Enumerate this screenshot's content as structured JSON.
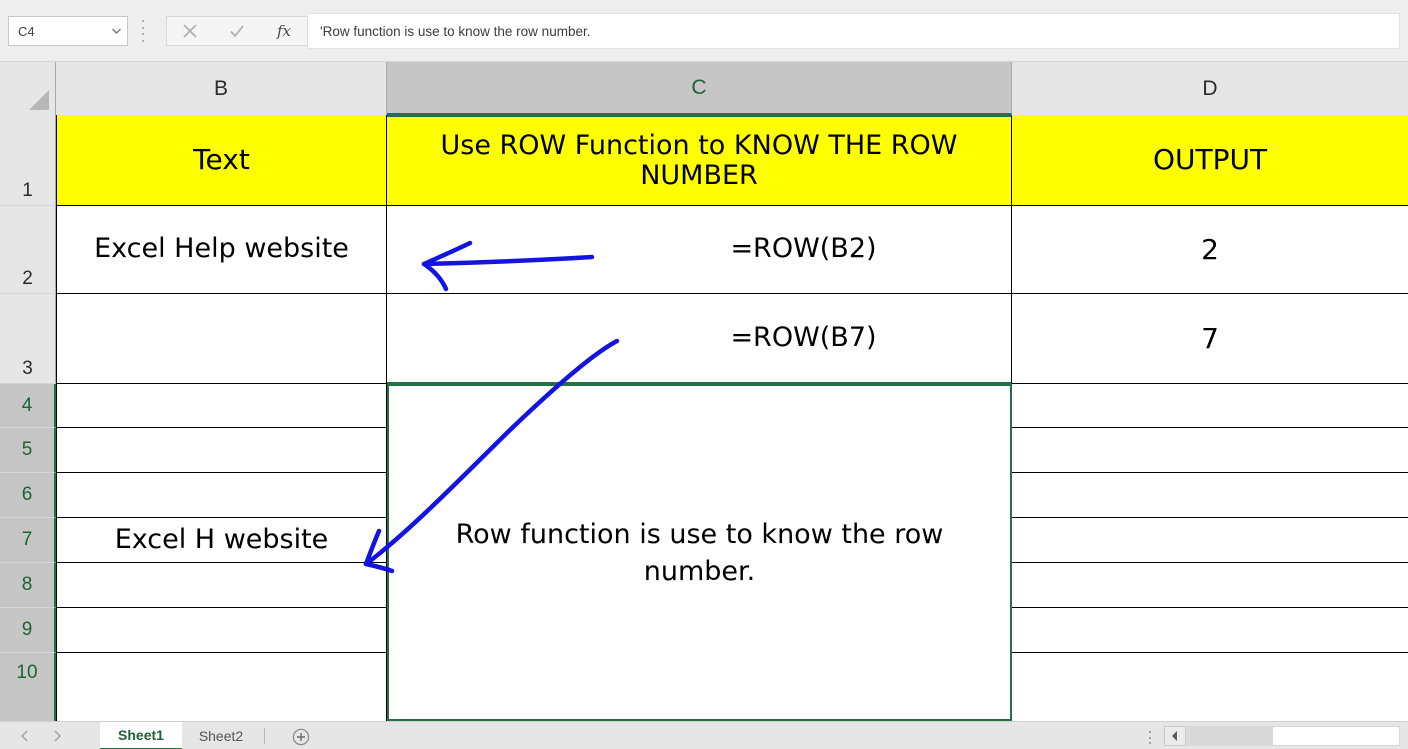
{
  "formula_bar": {
    "name_box_value": "C4",
    "name_box_dropdown_icon": "chevron-down-icon",
    "cancel_icon": "close-x-icon",
    "confirm_icon": "checkmark-icon",
    "function_icon": "fx-insert-function-icon",
    "formula_value": "'Row function is use to know the row number."
  },
  "grid": {
    "columns": [
      {
        "label": "B",
        "selected": false
      },
      {
        "label": "C",
        "selected": true
      },
      {
        "label": "D",
        "selected": false
      }
    ],
    "rows": [
      {
        "label": "1",
        "selected": false
      },
      {
        "label": "2",
        "selected": false
      },
      {
        "label": "3",
        "selected": false
      },
      {
        "label": "4",
        "selected": true
      },
      {
        "label": "5",
        "selected": true
      },
      {
        "label": "6",
        "selected": true
      },
      {
        "label": "7",
        "selected": true
      },
      {
        "label": "8",
        "selected": true
      },
      {
        "label": "9",
        "selected": true
      },
      {
        "label": "10",
        "selected": true
      }
    ],
    "cells": {
      "b1": "Text",
      "c1": "Use ROW Function to KNOW THE ROW NUMBER",
      "d1": "OUTPUT",
      "b2": "Excel Help website",
      "c2": "=ROW(B2)",
      "d2": "2",
      "b3": "",
      "c3": "=ROW(B7)",
      "d3": "7",
      "c4_merged": "Row function is use to know the row number.",
      "b7": "Excel H website"
    },
    "colors": {
      "header_fill": "#FFFF00",
      "selection_green": "#217346",
      "annotation_blue": "#1414e0"
    }
  },
  "annotations": {
    "arrow_to_b2": "hand-drawn-left-arrow",
    "arrow_to_b7": "hand-drawn-diagonal-arrow"
  },
  "tab_bar": {
    "first_sheet_icon": "nav-previous-icon",
    "last_sheet_icon": "nav-next-icon",
    "sheets": [
      {
        "label": "Sheet1",
        "active": true
      },
      {
        "label": "Sheet2",
        "active": false
      }
    ],
    "add_sheet_icon": "add-circle-icon",
    "scroll_grip_icon": "scroll-grip-icon",
    "scroll_left_icon": "scroll-left-arrow-icon"
  }
}
